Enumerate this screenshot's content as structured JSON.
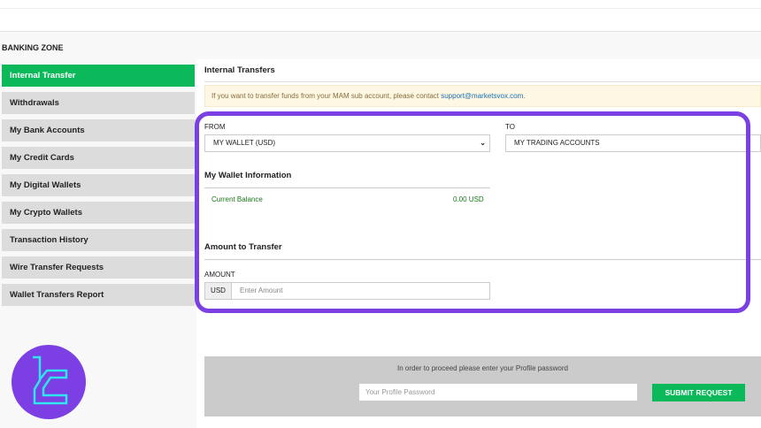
{
  "sidebar": {
    "title": "BANKING ZONE",
    "items": [
      {
        "label": "Internal Transfer",
        "active": true
      },
      {
        "label": "Withdrawals"
      },
      {
        "label": "My Bank Accounts"
      },
      {
        "label": "My Credit Cards"
      },
      {
        "label": "My Digital Wallets"
      },
      {
        "label": "My Crypto Wallets"
      },
      {
        "label": "Transaction History"
      },
      {
        "label": "Wire Transfer Requests"
      },
      {
        "label": "Wallet Transfers Report"
      }
    ]
  },
  "main": {
    "title": "Internal Transfers",
    "notice_text": "If you want to transfer funds from your MAM sub account, please contact ",
    "notice_link": "support@marketsvox.com",
    "notice_end": ".",
    "from_label": "FROM",
    "from_value": "MY WALLET (USD)",
    "to_label": "TO",
    "to_value": "MY TRADING ACCOUNTS",
    "wallet_heading": "My Wallet Information",
    "balance_label": "Current Balance",
    "balance_value": "0.00 USD",
    "amount_heading": "Amount to Transfer",
    "amount_label": "AMOUNT",
    "currency": "USD",
    "amount_placeholder": "Enter Amount"
  },
  "submit": {
    "message": "In order to proceed please enter your Profile password",
    "password_placeholder": "Your Profile Password",
    "button": "SUBMIT REQUEST"
  },
  "colors": {
    "accent": "#0cb95a",
    "highlight": "#7b3fe4"
  }
}
